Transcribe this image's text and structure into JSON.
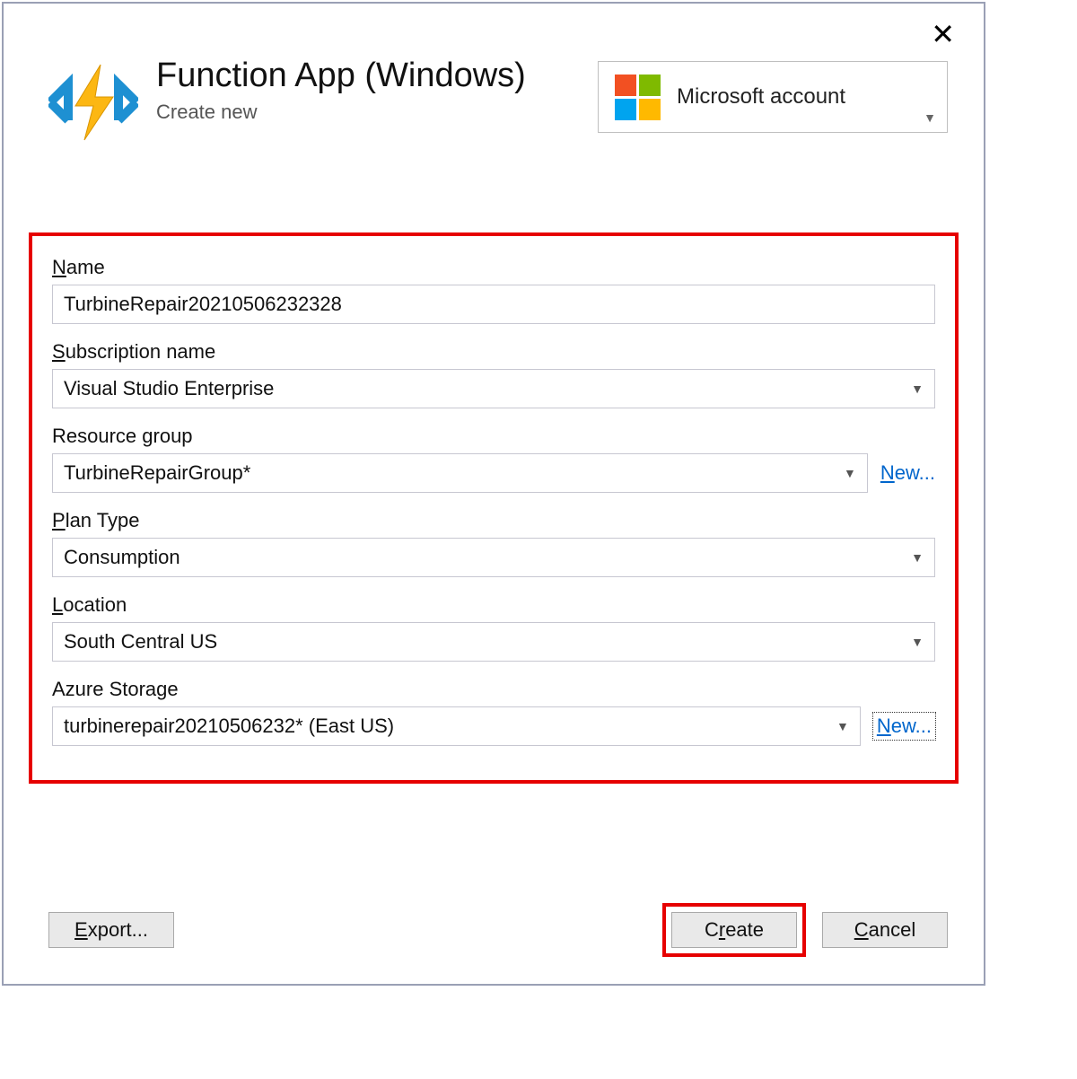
{
  "header": {
    "title": "Function App (Windows)",
    "subtitle": "Create new",
    "account_label": "Microsoft account"
  },
  "form": {
    "name": {
      "label": "Name",
      "value": "TurbineRepair20210506232328"
    },
    "subscription": {
      "label": "Subscription name",
      "value": "Visual Studio Enterprise"
    },
    "resource_group": {
      "label": "Resource group",
      "value": "TurbineRepairGroup*",
      "new_link": "New..."
    },
    "plan_type": {
      "label": "Plan Type",
      "value": "Consumption"
    },
    "location": {
      "label": "Location",
      "value": "South Central US"
    },
    "storage": {
      "label": "Azure Storage",
      "value": "turbinerepair20210506232* (East US)",
      "new_link": "New..."
    }
  },
  "footer": {
    "export": "Export...",
    "create": "Create",
    "cancel": "Cancel"
  }
}
